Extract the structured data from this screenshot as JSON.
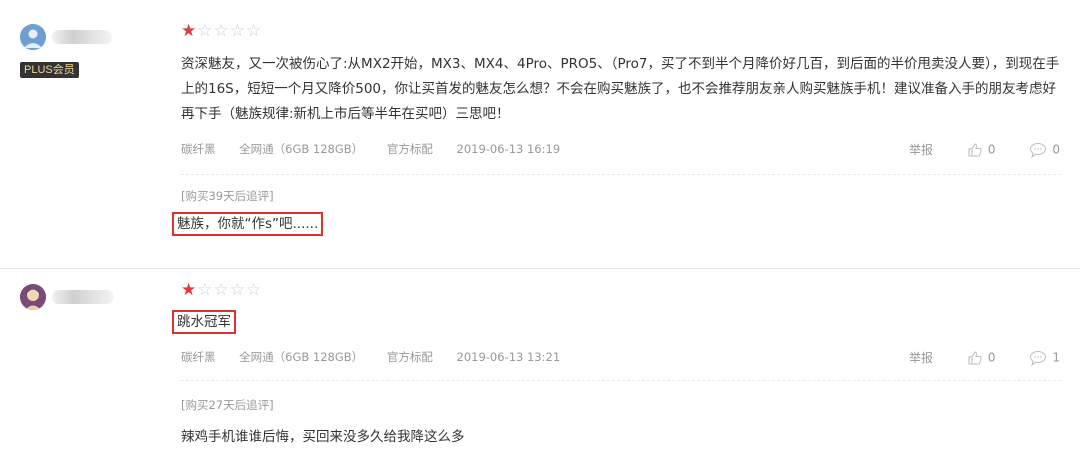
{
  "reviews": [
    {
      "badge": "PLUS会员",
      "stars": {
        "filled": "★",
        "empty": "☆☆☆☆",
        "rating": 1,
        "max": 5
      },
      "content": "资深魅友，又一次被伤心了:从MX2开始，MX3、MX4、4Pro、PRO5、（Pro7，买了不到半个月降价好几百，到后面的半价甩卖没人要），到现在手上的16S，短短一个月又降价500，你让买首发的魅友怎么想？不会在购买魅族了，也不会推荐朋友亲人购买魅族手机！建议准备入手的朋友考虑好再下手（魅族规律:新机上市后等半年在买吧）三思吧！",
      "meta": {
        "color": "碳纤黑",
        "version": "全网通（6GB 128GB）",
        "package": "官方标配",
        "date": "2019-06-13 16:19"
      },
      "actions": {
        "report": "举报",
        "likes": "0",
        "replies": "0"
      },
      "after": {
        "title": "[购买39天后追评]",
        "content": "魅族，你就“作s”吧......"
      }
    },
    {
      "stars": {
        "filled": "★",
        "empty": "☆☆☆☆",
        "rating": 1,
        "max": 5
      },
      "content": "跳水冠军",
      "meta": {
        "color": "碳纤黑",
        "version": "全网通（6GB 128GB）",
        "package": "官方标配",
        "date": "2019-06-13 13:21"
      },
      "actions": {
        "report": "举报",
        "likes": "0",
        "replies": "1"
      },
      "after": {
        "title": "[购买27天后追评]",
        "content": "辣鸡手机谁谁后悔，买回来没多久给我降这么多"
      }
    }
  ],
  "colors": {
    "star": "#e4393c",
    "highlight_box": "#e0322c",
    "meta_text": "#999999",
    "badge_bg": "#333333"
  }
}
